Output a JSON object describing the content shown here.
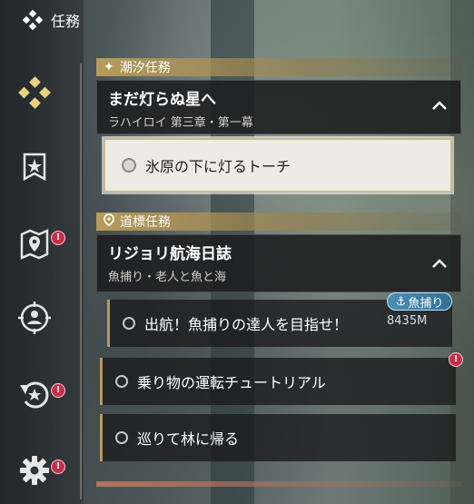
{
  "header": {
    "title": "任務",
    "icon": "quest-diamond-icon"
  },
  "nav": [
    {
      "name": "nav-quests",
      "icon": "quest-diamond-icon",
      "active": true
    },
    {
      "name": "nav-banner",
      "icon": "banner-star-icon"
    },
    {
      "name": "nav-map",
      "icon": "map-pin-icon",
      "alert": "!"
    },
    {
      "name": "nav-target",
      "icon": "target-person-icon"
    },
    {
      "name": "nav-return",
      "icon": "return-arrow-icon",
      "alert": "!"
    },
    {
      "name": "nav-settings",
      "icon": "gear-icon",
      "alert": "!"
    }
  ],
  "sections": {
    "tide": {
      "label": "潮汐任務",
      "icon": "sparkle-icon"
    },
    "waypoint": {
      "label": "道標任務",
      "icon": "location-pin-icon"
    }
  },
  "quest1": {
    "title": "まだ灯らぬ星へ",
    "subtitle": "ラハイロイ 第三章・第一幕",
    "active_task": "氷原の下に灯るトーチ"
  },
  "quest2": {
    "title": "リジョリ航海日誌",
    "subtitle": "魚捕り・老人と魚と海",
    "tasks": [
      {
        "label": "出航！魚捕りの達人を目指せ！"
      },
      {
        "label": "乗り物の運転チュートリアル",
        "alert": "!"
      },
      {
        "label": "巡りて林に帰る"
      }
    ],
    "tag": "魚捕り",
    "distance": "8435M"
  },
  "colors": {
    "accent": "#b99a5c",
    "alert": "#c4314b",
    "tag": "#2d6f96"
  }
}
